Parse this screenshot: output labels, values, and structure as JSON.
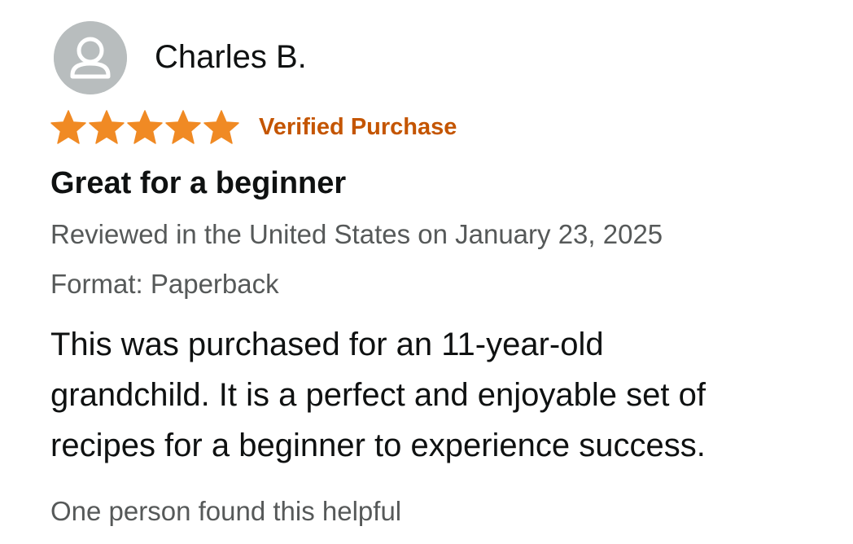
{
  "review": {
    "reviewer_name": "Charles B.",
    "avatar_icon": "user-silhouette-icon",
    "rating": 5,
    "rating_max": 5,
    "star_color": "#f08a24",
    "verified_label": "Verified Purchase",
    "verified_color": "#c45500",
    "title": "Great for a beginner",
    "date_line": "Reviewed in the United States on January 23, 2025",
    "format_line": "Format: Paperback",
    "body_lines": [
      "This was purchased for an 11-year-old",
      "grandchild. It is a perfect and enjoyable set of",
      "recipes for a beginner to experience success."
    ],
    "helpful_text": "One person found this helpful"
  }
}
